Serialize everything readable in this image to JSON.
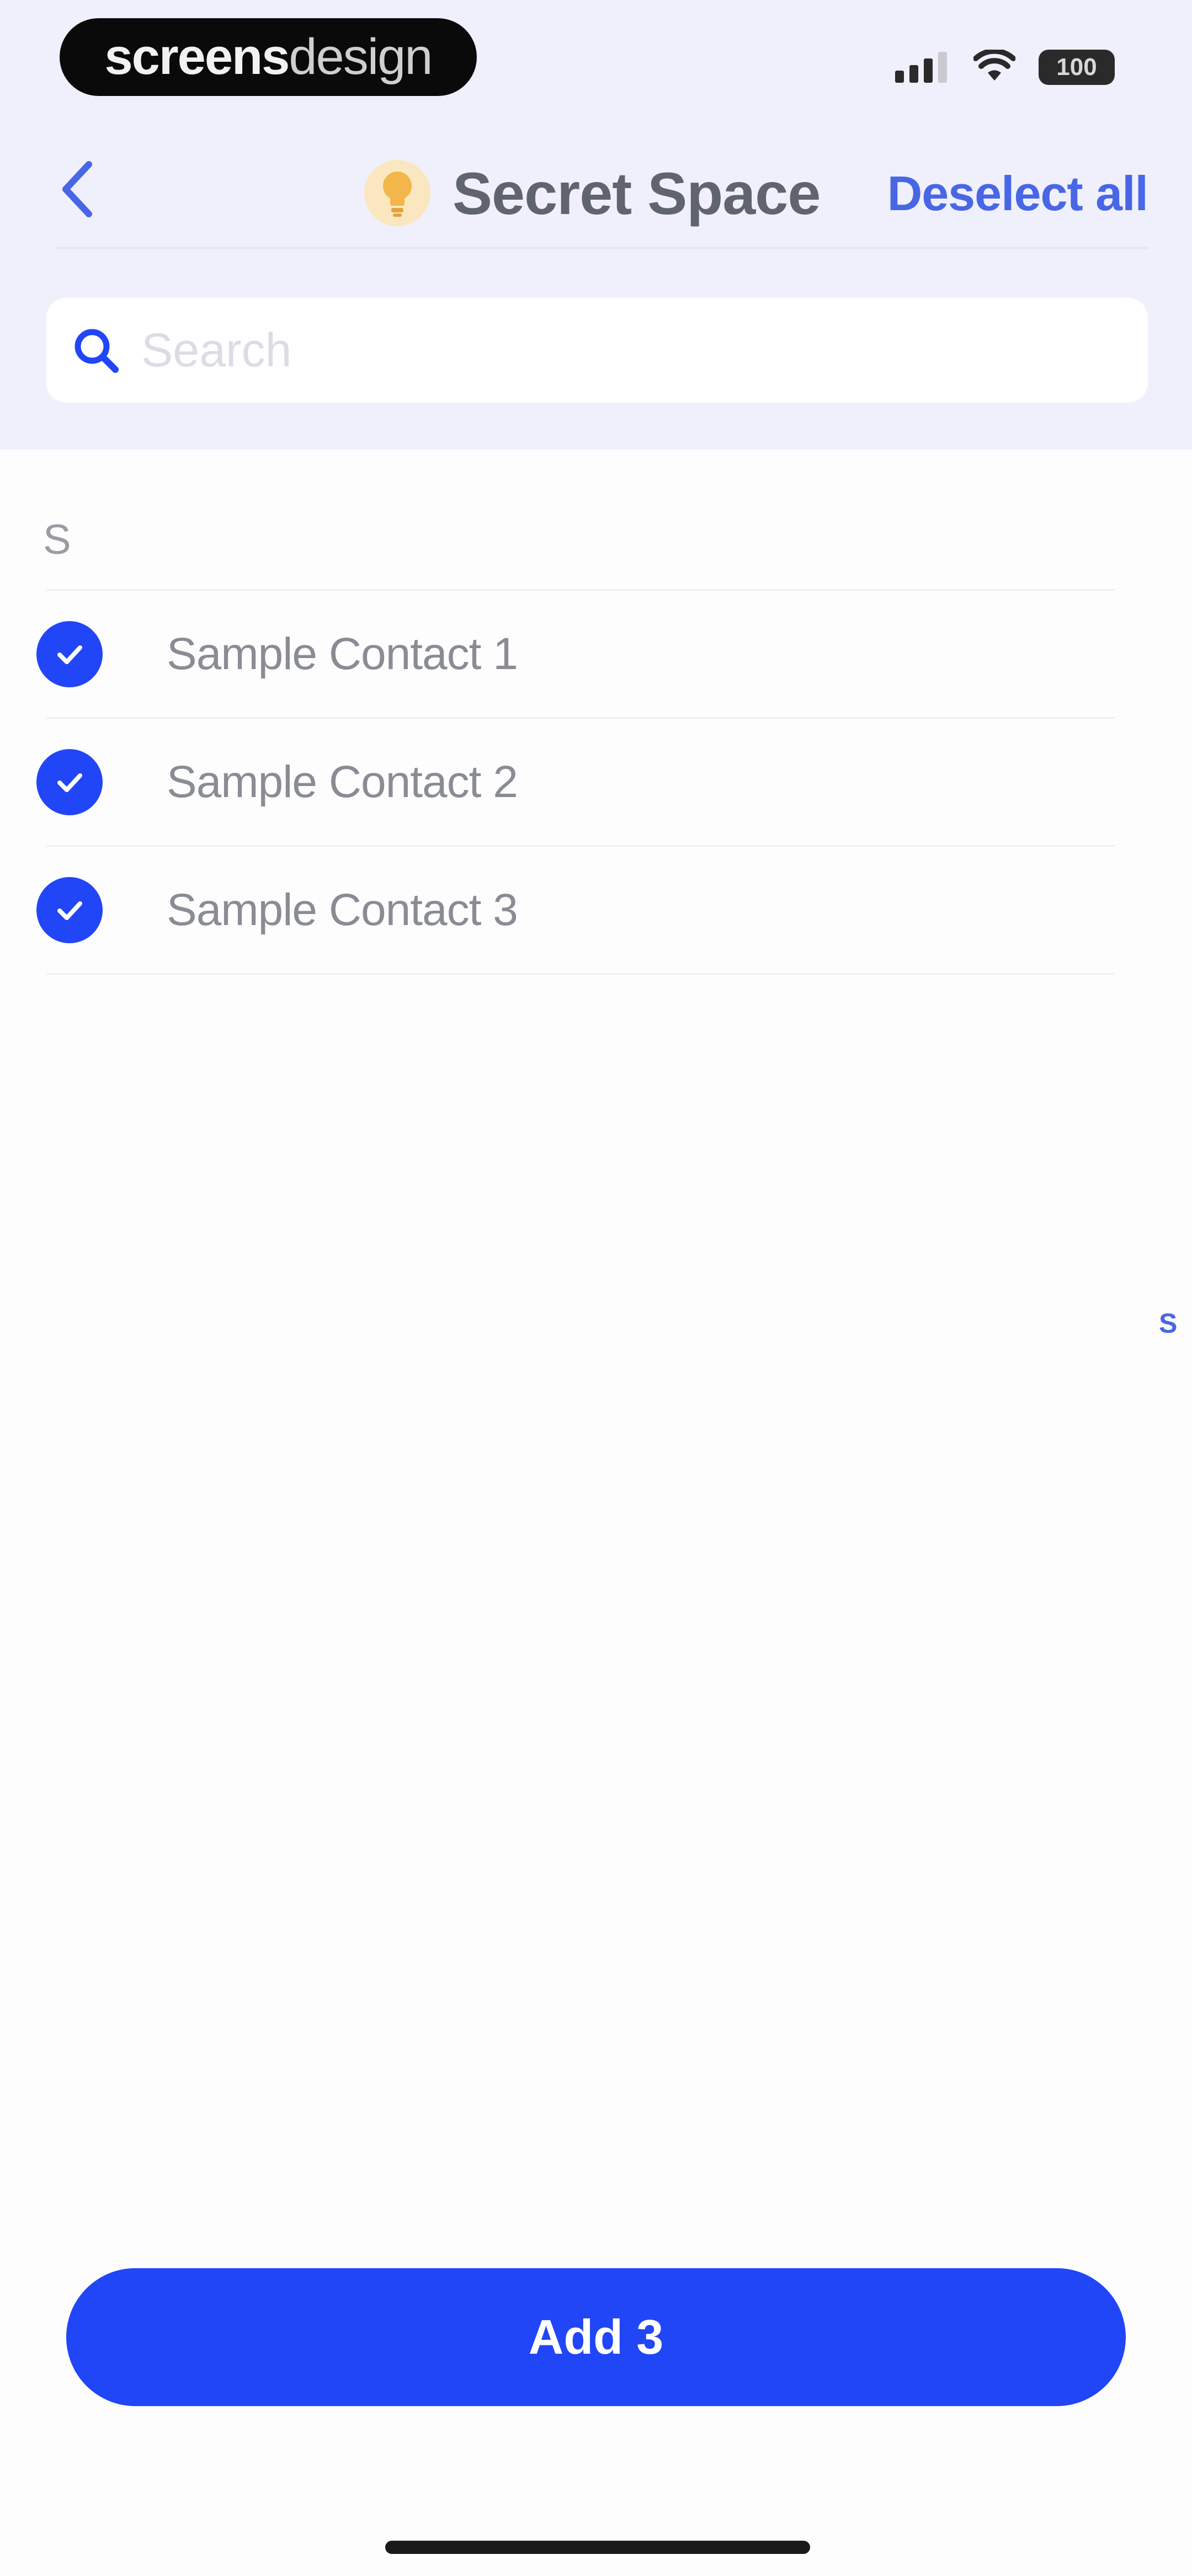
{
  "watermark": {
    "bold": "screens",
    "light": "design"
  },
  "status_bar": {
    "battery": "100"
  },
  "nav": {
    "back_icon": "chevron-left-icon",
    "title_icon": "lightbulb-icon",
    "title": "Secret Space",
    "deselect_label": "Deselect all"
  },
  "search": {
    "placeholder": "Search",
    "value": ""
  },
  "section": {
    "header": "S",
    "index_letter": "S"
  },
  "contacts": [
    {
      "name": "Sample Contact 1",
      "selected": true
    },
    {
      "name": "Sample Contact 2",
      "selected": true
    },
    {
      "name": "Sample Contact 3",
      "selected": true
    }
  ],
  "add_button_label": "Add 3",
  "colors": {
    "accent": "#2146f7",
    "link": "#4866e6",
    "header_bg": "#eff0fb",
    "bulb": "#f3b64a"
  }
}
